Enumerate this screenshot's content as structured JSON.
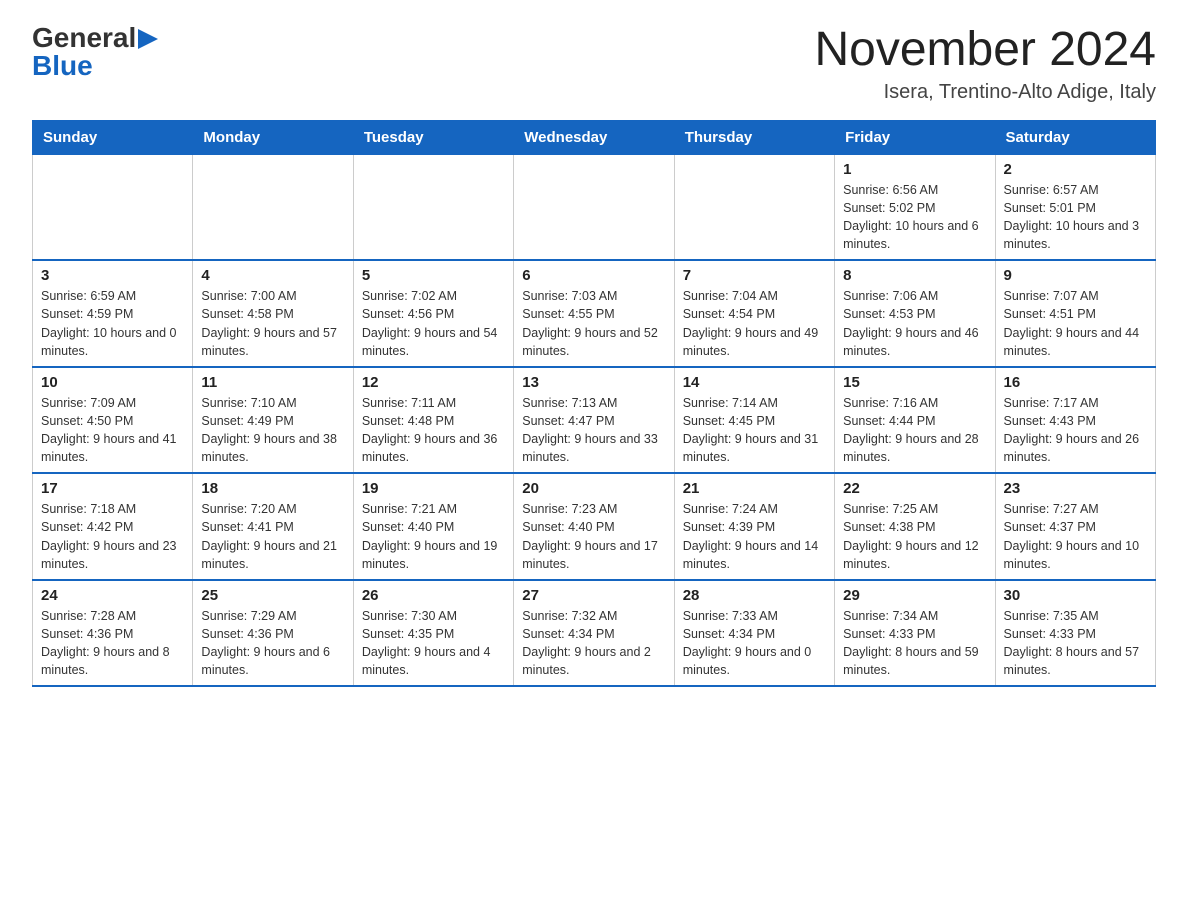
{
  "header": {
    "logo_general": "General",
    "logo_blue": "Blue",
    "month_title": "November 2024",
    "location": "Isera, Trentino-Alto Adige, Italy"
  },
  "calendar": {
    "days_of_week": [
      "Sunday",
      "Monday",
      "Tuesday",
      "Wednesday",
      "Thursday",
      "Friday",
      "Saturday"
    ],
    "weeks": [
      [
        {
          "day": "",
          "info": ""
        },
        {
          "day": "",
          "info": ""
        },
        {
          "day": "",
          "info": ""
        },
        {
          "day": "",
          "info": ""
        },
        {
          "day": "",
          "info": ""
        },
        {
          "day": "1",
          "info": "Sunrise: 6:56 AM\nSunset: 5:02 PM\nDaylight: 10 hours and 6 minutes."
        },
        {
          "day": "2",
          "info": "Sunrise: 6:57 AM\nSunset: 5:01 PM\nDaylight: 10 hours and 3 minutes."
        }
      ],
      [
        {
          "day": "3",
          "info": "Sunrise: 6:59 AM\nSunset: 4:59 PM\nDaylight: 10 hours and 0 minutes."
        },
        {
          "day": "4",
          "info": "Sunrise: 7:00 AM\nSunset: 4:58 PM\nDaylight: 9 hours and 57 minutes."
        },
        {
          "day": "5",
          "info": "Sunrise: 7:02 AM\nSunset: 4:56 PM\nDaylight: 9 hours and 54 minutes."
        },
        {
          "day": "6",
          "info": "Sunrise: 7:03 AM\nSunset: 4:55 PM\nDaylight: 9 hours and 52 minutes."
        },
        {
          "day": "7",
          "info": "Sunrise: 7:04 AM\nSunset: 4:54 PM\nDaylight: 9 hours and 49 minutes."
        },
        {
          "day": "8",
          "info": "Sunrise: 7:06 AM\nSunset: 4:53 PM\nDaylight: 9 hours and 46 minutes."
        },
        {
          "day": "9",
          "info": "Sunrise: 7:07 AM\nSunset: 4:51 PM\nDaylight: 9 hours and 44 minutes."
        }
      ],
      [
        {
          "day": "10",
          "info": "Sunrise: 7:09 AM\nSunset: 4:50 PM\nDaylight: 9 hours and 41 minutes."
        },
        {
          "day": "11",
          "info": "Sunrise: 7:10 AM\nSunset: 4:49 PM\nDaylight: 9 hours and 38 minutes."
        },
        {
          "day": "12",
          "info": "Sunrise: 7:11 AM\nSunset: 4:48 PM\nDaylight: 9 hours and 36 minutes."
        },
        {
          "day": "13",
          "info": "Sunrise: 7:13 AM\nSunset: 4:47 PM\nDaylight: 9 hours and 33 minutes."
        },
        {
          "day": "14",
          "info": "Sunrise: 7:14 AM\nSunset: 4:45 PM\nDaylight: 9 hours and 31 minutes."
        },
        {
          "day": "15",
          "info": "Sunrise: 7:16 AM\nSunset: 4:44 PM\nDaylight: 9 hours and 28 minutes."
        },
        {
          "day": "16",
          "info": "Sunrise: 7:17 AM\nSunset: 4:43 PM\nDaylight: 9 hours and 26 minutes."
        }
      ],
      [
        {
          "day": "17",
          "info": "Sunrise: 7:18 AM\nSunset: 4:42 PM\nDaylight: 9 hours and 23 minutes."
        },
        {
          "day": "18",
          "info": "Sunrise: 7:20 AM\nSunset: 4:41 PM\nDaylight: 9 hours and 21 minutes."
        },
        {
          "day": "19",
          "info": "Sunrise: 7:21 AM\nSunset: 4:40 PM\nDaylight: 9 hours and 19 minutes."
        },
        {
          "day": "20",
          "info": "Sunrise: 7:23 AM\nSunset: 4:40 PM\nDaylight: 9 hours and 17 minutes."
        },
        {
          "day": "21",
          "info": "Sunrise: 7:24 AM\nSunset: 4:39 PM\nDaylight: 9 hours and 14 minutes."
        },
        {
          "day": "22",
          "info": "Sunrise: 7:25 AM\nSunset: 4:38 PM\nDaylight: 9 hours and 12 minutes."
        },
        {
          "day": "23",
          "info": "Sunrise: 7:27 AM\nSunset: 4:37 PM\nDaylight: 9 hours and 10 minutes."
        }
      ],
      [
        {
          "day": "24",
          "info": "Sunrise: 7:28 AM\nSunset: 4:36 PM\nDaylight: 9 hours and 8 minutes."
        },
        {
          "day": "25",
          "info": "Sunrise: 7:29 AM\nSunset: 4:36 PM\nDaylight: 9 hours and 6 minutes."
        },
        {
          "day": "26",
          "info": "Sunrise: 7:30 AM\nSunset: 4:35 PM\nDaylight: 9 hours and 4 minutes."
        },
        {
          "day": "27",
          "info": "Sunrise: 7:32 AM\nSunset: 4:34 PM\nDaylight: 9 hours and 2 minutes."
        },
        {
          "day": "28",
          "info": "Sunrise: 7:33 AM\nSunset: 4:34 PM\nDaylight: 9 hours and 0 minutes."
        },
        {
          "day": "29",
          "info": "Sunrise: 7:34 AM\nSunset: 4:33 PM\nDaylight: 8 hours and 59 minutes."
        },
        {
          "day": "30",
          "info": "Sunrise: 7:35 AM\nSunset: 4:33 PM\nDaylight: 8 hours and 57 minutes."
        }
      ]
    ]
  }
}
